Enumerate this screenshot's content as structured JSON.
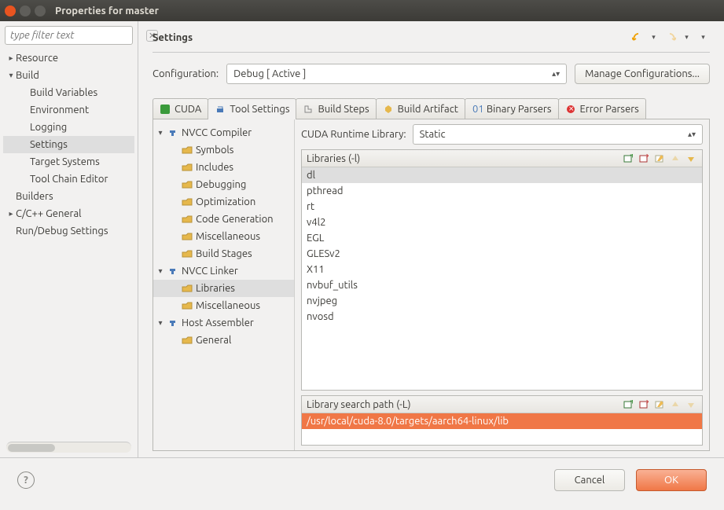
{
  "window": {
    "title": "Properties for master"
  },
  "sidebar": {
    "filter_placeholder": "type filter text",
    "items": [
      {
        "label": "Resource",
        "twisty": "▸",
        "indent": 0
      },
      {
        "label": "Build",
        "twisty": "▾",
        "indent": 0
      },
      {
        "label": "Build Variables",
        "twisty": "",
        "indent": 1
      },
      {
        "label": "Environment",
        "twisty": "",
        "indent": 1
      },
      {
        "label": "Logging",
        "twisty": "",
        "indent": 1
      },
      {
        "label": "Settings",
        "twisty": "",
        "indent": 1,
        "selected": true
      },
      {
        "label": "Target Systems",
        "twisty": "",
        "indent": 1
      },
      {
        "label": "Tool Chain Editor",
        "twisty": "",
        "indent": 1
      },
      {
        "label": "Builders",
        "twisty": "",
        "indent": 0
      },
      {
        "label": "C/C++ General",
        "twisty": "▸",
        "indent": 0
      },
      {
        "label": "Run/Debug Settings",
        "twisty": "",
        "indent": 0
      }
    ]
  },
  "header": {
    "title": "Settings"
  },
  "config": {
    "label": "Configuration:",
    "value": "Debug  [ Active ]",
    "manage": "Manage Configurations..."
  },
  "tabs": [
    {
      "label": "CUDA"
    },
    {
      "label": "Tool Settings",
      "active": true
    },
    {
      "label": "Build Steps"
    },
    {
      "label": "Build Artifact"
    },
    {
      "label": "Binary Parsers"
    },
    {
      "label": "Error Parsers"
    }
  ],
  "tooltree": [
    {
      "label": "NVCC Compiler",
      "icon": "tool",
      "twisty": "▾",
      "indent": 0
    },
    {
      "label": "Symbols",
      "icon": "opt",
      "twisty": "",
      "indent": 1
    },
    {
      "label": "Includes",
      "icon": "opt",
      "twisty": "",
      "indent": 1
    },
    {
      "label": "Debugging",
      "icon": "opt",
      "twisty": "",
      "indent": 1
    },
    {
      "label": "Optimization",
      "icon": "opt",
      "twisty": "",
      "indent": 1
    },
    {
      "label": "Code Generation",
      "icon": "opt",
      "twisty": "",
      "indent": 1
    },
    {
      "label": "Miscellaneous",
      "icon": "opt",
      "twisty": "",
      "indent": 1
    },
    {
      "label": "Build Stages",
      "icon": "opt",
      "twisty": "",
      "indent": 1
    },
    {
      "label": "NVCC Linker",
      "icon": "tool",
      "twisty": "▾",
      "indent": 0
    },
    {
      "label": "Libraries",
      "icon": "opt",
      "twisty": "",
      "indent": 1,
      "selected": true
    },
    {
      "label": "Miscellaneous",
      "icon": "opt",
      "twisty": "",
      "indent": 1
    },
    {
      "label": "Host Assembler",
      "icon": "tool",
      "twisty": "▾",
      "indent": 0
    },
    {
      "label": "General",
      "icon": "opt",
      "twisty": "",
      "indent": 1
    }
  ],
  "runtime": {
    "label": "CUDA Runtime Library:",
    "value": "Static"
  },
  "libs": {
    "title": "Libraries (-l)",
    "items": [
      "dl",
      "pthread",
      "rt",
      "v4l2",
      "EGL",
      "GLESv2",
      "X11",
      "nvbuf_utils",
      "nvjpeg",
      "nvosd"
    ],
    "selected": 0
  },
  "libpath": {
    "title": "Library search path (-L)",
    "items": [
      "/usr/local/cuda-8.0/targets/aarch64-linux/lib"
    ],
    "selected": 0
  },
  "footer": {
    "cancel": "Cancel",
    "ok": "OK"
  }
}
